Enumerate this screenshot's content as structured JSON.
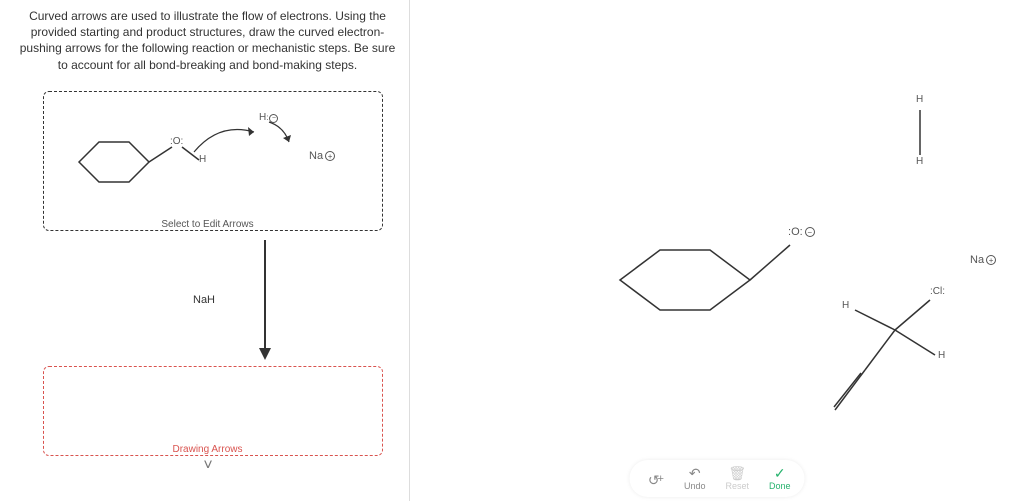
{
  "prompt": "Curved arrows are used to illustrate the flow of electrons. Using the provided starting and product structures, draw the curved electron-pushing arrows for the following reaction or mechanistic steps. Be sure to account for all bond-breaking and bond-making steps.",
  "step1": {
    "caption": "Select to Edit Arrows",
    "labels": {
      "h_anion": "H",
      "na_cation": "Na",
      "small_h": "H"
    }
  },
  "reaction_arrow": {
    "reagent": "NaH"
  },
  "step2": {
    "caption": "Drawing Arrows"
  },
  "canvas": {
    "labels": {
      "o_anion": "O",
      "na_cation": "Na",
      "h_top1": "H",
      "h_top2": "H",
      "h_left": "H",
      "h_right": "H",
      "cl": "Cl"
    }
  },
  "toolbar": {
    "add": "+",
    "undo": "Undo",
    "reset": "Reset",
    "done": "Done"
  }
}
